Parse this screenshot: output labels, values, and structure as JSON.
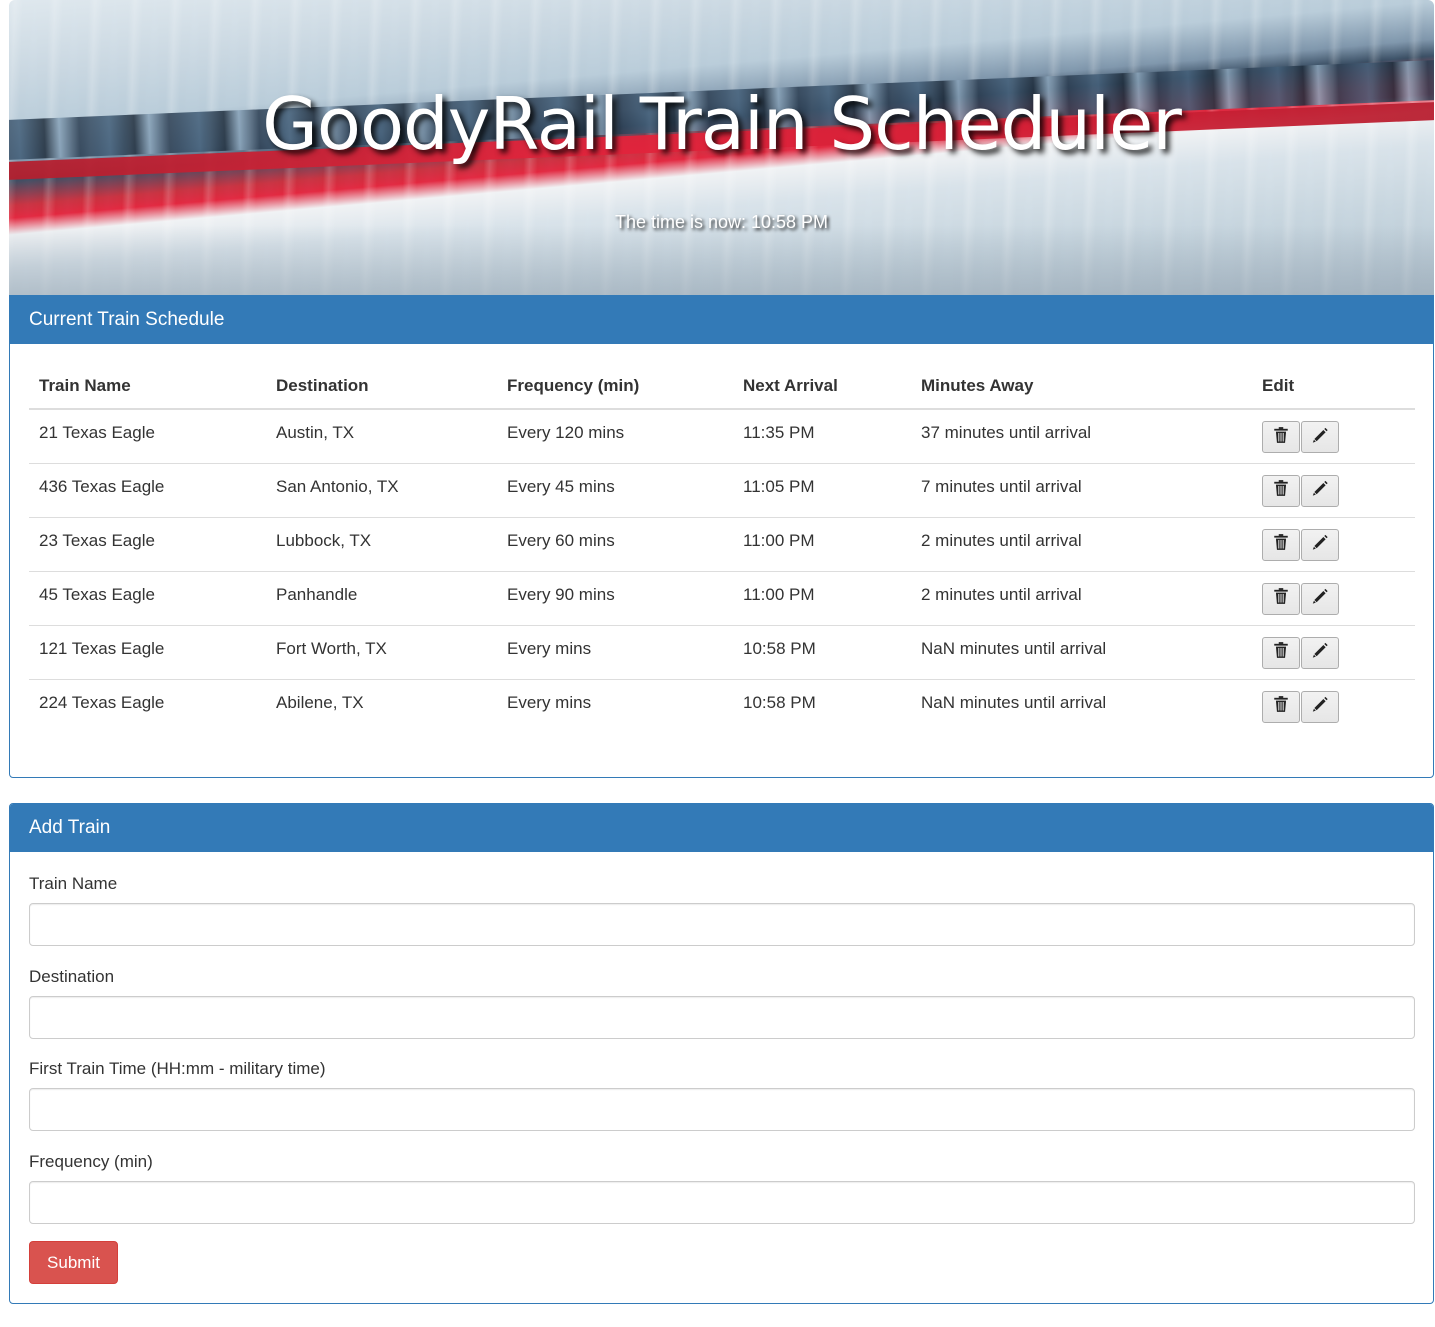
{
  "hero": {
    "title": "GoodyRail Train Scheduler",
    "time_text": "The time is now: 10:58 PM"
  },
  "schedule": {
    "heading": "Current Train Schedule",
    "columns": [
      "Train Name",
      "Destination",
      "Frequency (min)",
      "Next Arrival",
      "Minutes Away",
      "Edit"
    ],
    "rows": [
      {
        "name": "21 Texas Eagle",
        "destination": "Austin, TX",
        "frequency": "Every 120 mins",
        "next_arrival": "11:35 PM",
        "minutes_away": "37 minutes until arrival"
      },
      {
        "name": "436 Texas Eagle",
        "destination": "San Antonio, TX",
        "frequency": "Every 45 mins",
        "next_arrival": "11:05 PM",
        "minutes_away": "7 minutes until arrival"
      },
      {
        "name": "23 Texas Eagle",
        "destination": "Lubbock, TX",
        "frequency": "Every 60 mins",
        "next_arrival": "11:00 PM",
        "minutes_away": "2 minutes until arrival"
      },
      {
        "name": "45 Texas Eagle",
        "destination": "Panhandle",
        "frequency": "Every 90 mins",
        "next_arrival": "11:00 PM",
        "minutes_away": "2 minutes until arrival"
      },
      {
        "name": "121 Texas Eagle",
        "destination": "Fort Worth, TX",
        "frequency": "Every mins",
        "next_arrival": "10:58 PM",
        "minutes_away": "NaN minutes until arrival"
      },
      {
        "name": "224 Texas Eagle",
        "destination": "Abilene, TX",
        "frequency": "Every mins",
        "next_arrival": "10:58 PM",
        "minutes_away": "NaN minutes until arrival"
      }
    ],
    "row_actions": {
      "delete_icon": "trash-icon",
      "edit_icon": "pencil-icon"
    }
  },
  "add_train": {
    "heading": "Add Train",
    "fields": [
      {
        "label": "Train Name",
        "value": ""
      },
      {
        "label": "Destination",
        "value": ""
      },
      {
        "label": "First Train Time (HH:mm - military time)",
        "value": ""
      },
      {
        "label": "Frequency (min)",
        "value": ""
      }
    ],
    "submit_label": "Submit"
  },
  "colors": {
    "panel_primary": "#337ab7",
    "submit_danger": "#d9534f",
    "hero_stripe": "#e3243c"
  }
}
